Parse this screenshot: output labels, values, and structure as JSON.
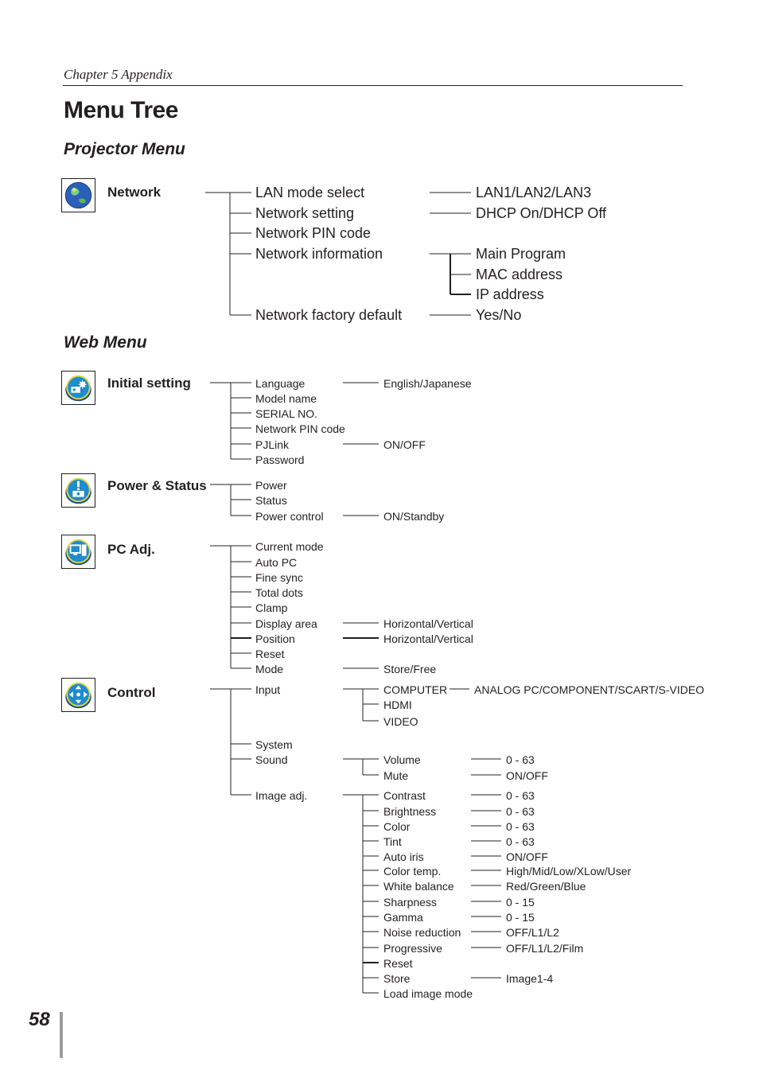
{
  "header": {
    "chapter": "Chapter 5 Appendix",
    "title": "Menu Tree"
  },
  "page_number": "58",
  "projector_menu": {
    "heading": "Projector Menu",
    "category": {
      "label": "Network",
      "icon": "globe-icon"
    },
    "items": [
      {
        "label": "LAN mode select",
        "options": [
          "LAN1/LAN2/LAN3"
        ]
      },
      {
        "label": "Network setting",
        "options": [
          "DHCP On/DHCP Off"
        ]
      },
      {
        "label": "Network PIN code",
        "options": []
      },
      {
        "label": "Network information",
        "options": [
          "Main Program",
          "MAC address",
          "IP address"
        ]
      },
      {
        "label": "Network factory default",
        "options": [
          "Yes/No"
        ]
      }
    ]
  },
  "web_menu": {
    "heading": "Web Menu",
    "categories": [
      {
        "label": "Initial setting",
        "icon": "settings-icon",
        "items": [
          {
            "label": "Language",
            "value": "English/Japanese"
          },
          {
            "label": "Model name"
          },
          {
            "label": "SERIAL NO."
          },
          {
            "label": "Network PIN code"
          },
          {
            "label": "PJLink",
            "value": "ON/OFF"
          },
          {
            "label": "Password"
          }
        ]
      },
      {
        "label": "Power & Status",
        "icon": "power-status-icon",
        "items": [
          {
            "label": "Power"
          },
          {
            "label": "Status"
          },
          {
            "label": "Power control",
            "value": "ON/Standby"
          }
        ]
      },
      {
        "label": "PC Adj.",
        "icon": "pc-monitor-icon",
        "items": [
          {
            "label": "Current mode"
          },
          {
            "label": "Auto PC"
          },
          {
            "label": "Fine sync"
          },
          {
            "label": "Total dots"
          },
          {
            "label": "Clamp"
          },
          {
            "label": "Display area",
            "value": "Horizontal/Vertical"
          },
          {
            "label": "Position",
            "value": "Horizontal/Vertical"
          },
          {
            "label": "Reset"
          },
          {
            "label": "Mode",
            "value": "Store/Free"
          }
        ]
      },
      {
        "label": "Control",
        "icon": "control-arrows-icon",
        "items": [
          {
            "label": "Input",
            "children": [
              {
                "label": "COMPUTER",
                "value": "ANALOG PC/COMPONENT/SCART/S-VIDEO"
              },
              {
                "label": "HDMI"
              },
              {
                "label": "VIDEO"
              }
            ]
          },
          {
            "label": "System"
          },
          {
            "label": "Sound",
            "children": [
              {
                "label": "Volume",
                "value": "0 - 63"
              },
              {
                "label": "Mute",
                "value": "ON/OFF"
              }
            ]
          },
          {
            "label": "Image adj.",
            "children": [
              {
                "label": "Contrast",
                "value": "0 - 63"
              },
              {
                "label": "Brightness",
                "value": "0 - 63"
              },
              {
                "label": "Color",
                "value": "0 - 63"
              },
              {
                "label": "Tint",
                "value": "0 - 63"
              },
              {
                "label": "Auto iris",
                "value": "ON/OFF"
              },
              {
                "label": "Color temp.",
                "value": "High/Mid/Low/XLow/User"
              },
              {
                "label": "White balance",
                "value": "Red/Green/Blue"
              },
              {
                "label": "Sharpness",
                "value": "0 - 15"
              },
              {
                "label": "Gamma",
                "value": "0 - 15"
              },
              {
                "label": "Noise reduction",
                "value": "OFF/L1/L2"
              },
              {
                "label": "Progressive",
                "value": "OFF/L1/L2/Film"
              },
              {
                "label": "Reset"
              },
              {
                "label": "Store",
                "value": "Image1-4"
              },
              {
                "label": "Load image mode"
              }
            ]
          }
        ]
      }
    ]
  }
}
